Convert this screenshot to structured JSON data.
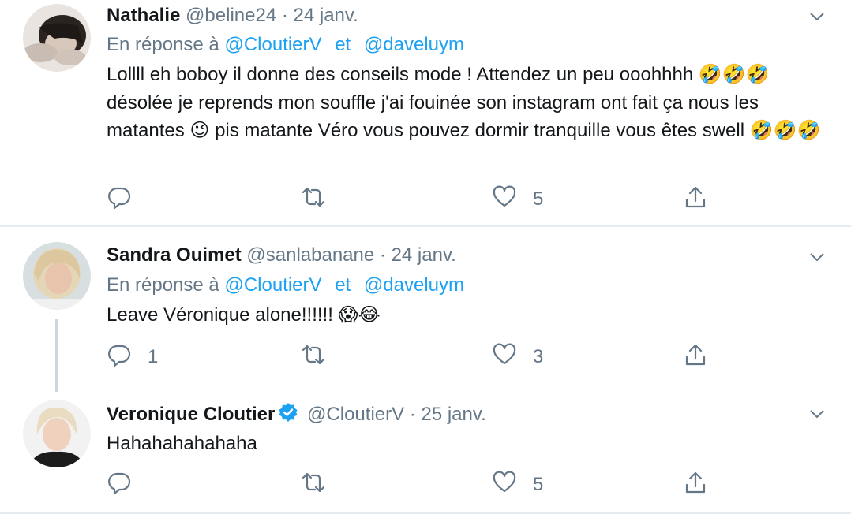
{
  "tweets": [
    {
      "name": "Nathalie",
      "handle": "@beline24",
      "separator": "·",
      "date": "24 janv.",
      "reply_prefix": "En réponse à",
      "reply_mention_1": "@CloutierV",
      "reply_conj": "et",
      "reply_mention_2": "@daveluym",
      "text": "Lollll eh boboy il donne des conseils mode ! Attendez un peu ooohhhh 🤣🤣🤣 désolée je reprends mon souffle j'ai fouinée son instagram ont fait ça nous les matantes 😉 pis matante Véro vous pouvez dormir tranquille vous êtes  swell 🤣🤣🤣",
      "reply_count": "",
      "retweet_count": "",
      "like_count": "5"
    },
    {
      "name": "Sandra Ouimet",
      "handle": "@sanlabanane",
      "separator": "·",
      "date": "24 janv.",
      "reply_prefix": "En réponse à",
      "reply_mention_1": "@CloutierV",
      "reply_conj": "et",
      "reply_mention_2": "@daveluym",
      "text": "Leave Véronique alone!!!!!! 😱😂",
      "reply_count": "1",
      "retweet_count": "",
      "like_count": "3"
    },
    {
      "name": "Veronique Cloutier",
      "verified": true,
      "handle": "@CloutierV",
      "separator": "·",
      "date": "25 janv.",
      "text": "Hahahahahahaha",
      "reply_count": "",
      "retweet_count": "",
      "like_count": "5"
    }
  ],
  "colors": {
    "text": "#14171a",
    "secondary": "#657786",
    "link": "#1da1f2",
    "verified": "#1da1f2",
    "divider": "#e6ecf0",
    "thread_line": "#ccd6dd"
  },
  "icons": {
    "reply": "reply-icon",
    "retweet": "retweet-icon",
    "like": "heart-icon",
    "share": "share-icon",
    "menu": "chevron-down-icon",
    "verified": "verified-badge-icon"
  }
}
